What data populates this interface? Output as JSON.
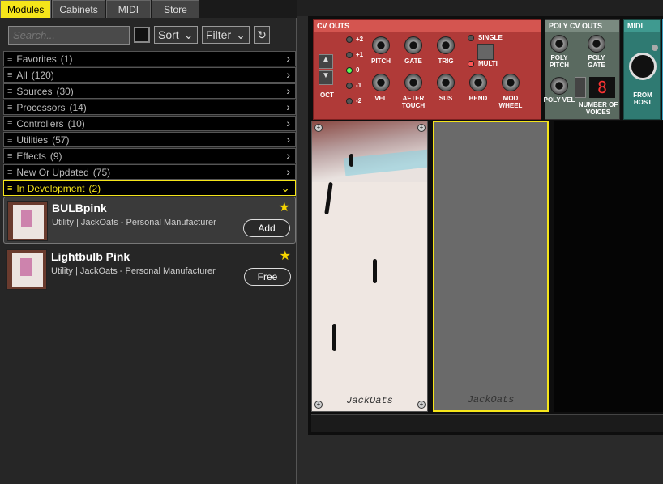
{
  "tabs": [
    {
      "label": "Modules",
      "active": true
    },
    {
      "label": "Cabinets"
    },
    {
      "label": "MIDI"
    },
    {
      "label": "Store"
    }
  ],
  "toolbar": {
    "search_placeholder": "Search...",
    "sort_label": "Sort",
    "filter_label": "Filter"
  },
  "categories": [
    {
      "label": "Favorites",
      "count": "(1)"
    },
    {
      "label": "All",
      "count": "(120)"
    },
    {
      "label": "Sources",
      "count": "(30)"
    },
    {
      "label": "Processors",
      "count": "(14)"
    },
    {
      "label": "Controllers",
      "count": "(10)"
    },
    {
      "label": "Utilities",
      "count": "(57)"
    },
    {
      "label": "Effects",
      "count": "(9)"
    },
    {
      "label": "New Or Updated",
      "count": "(75)"
    },
    {
      "label": "In Development",
      "count": "(2)",
      "selected": true
    }
  ],
  "modules": [
    {
      "name": "BULBpink",
      "desc": "Utility  |  JackOats - Personal Manufacturer",
      "button": "Add",
      "selected": true
    },
    {
      "name": "Lightbulb Pink",
      "desc": "Utility  |  JackOats - Personal Manufacturer",
      "button": "Free"
    }
  ],
  "rack": {
    "cv_outs": {
      "title": "CV OUTS",
      "oct_values": [
        "+2",
        "+1",
        "0",
        "-1",
        "-2"
      ],
      "oct_label": "OCT",
      "mode_single": "SINGLE",
      "mode_multi": "MULTI",
      "jacks_top": [
        "PITCH",
        "GATE",
        "TRIG"
      ],
      "jacks_bottom": [
        "VEL",
        "AFTER TOUCH",
        "SUS",
        "BEND",
        "MOD WHEEL"
      ]
    },
    "poly_cv_outs": {
      "title": "POLY CV OUTS",
      "labels": [
        "POLY PITCH",
        "POLY GATE",
        "POLY VEL"
      ],
      "voices_label": "NUMBER OF VOICES",
      "voices_value": "8"
    },
    "midi": {
      "title": "MIDI",
      "from_host": "FROM HOST"
    },
    "brand1": "JackOats",
    "brand2": "JackOats"
  }
}
